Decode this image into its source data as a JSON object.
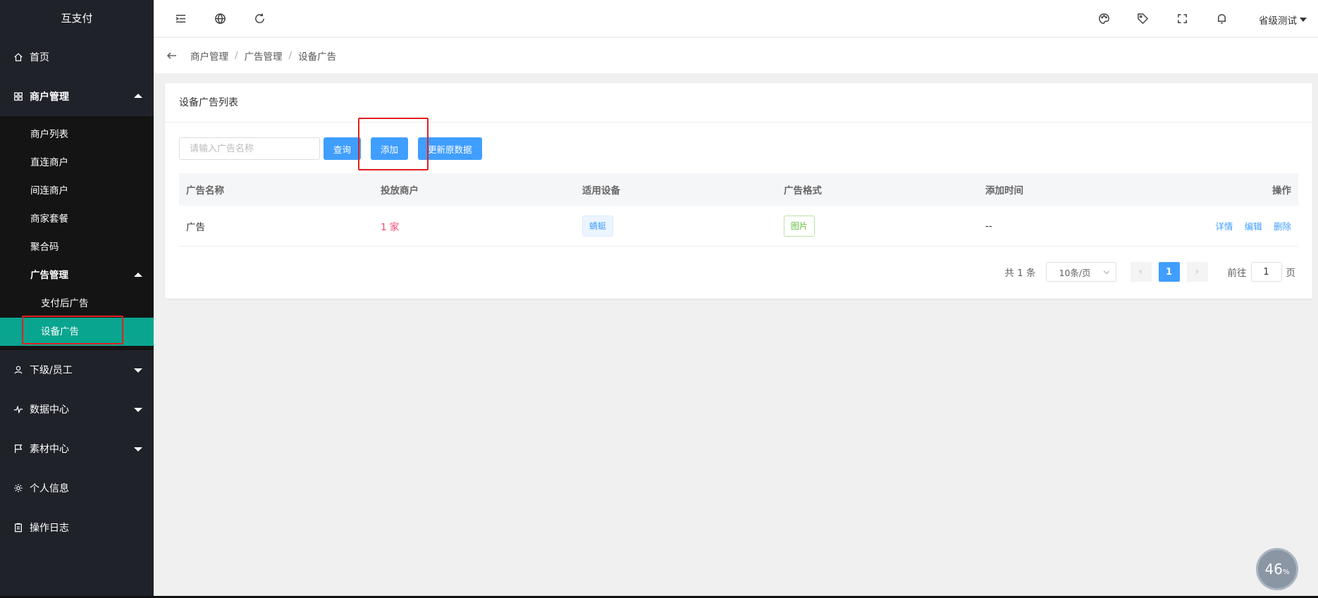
{
  "app": {
    "title": "互支付"
  },
  "sidebar": {
    "home": "首页",
    "merchant_mgmt": "商户管理",
    "merchant_sub": [
      "商户列表",
      "直连商户",
      "间连商户",
      "商家套餐",
      "聚合码"
    ],
    "ad_mgmt": "广告管理",
    "ad_sub": [
      "支付后广告",
      "设备广告"
    ],
    "subordinates": "下级/员工",
    "data_center": "数据中心",
    "material_center": "素材中心",
    "profile": "个人信息",
    "op_log": "操作日志"
  },
  "topbar": {
    "user": "省级测试"
  },
  "breadcrumb": [
    "商户管理",
    "广告管理",
    "设备广告"
  ],
  "card": {
    "title": "设备广告列表",
    "search_placeholder": "请输入广告名称",
    "btn_query": "查询",
    "btn_add": "添加",
    "btn_update": "更新原数据"
  },
  "table": {
    "headers": [
      "广告名称",
      "投放商户",
      "适用设备",
      "广告格式",
      "添加时间",
      "操作"
    ],
    "rows": [
      {
        "name": "广告",
        "merchant": "1 家",
        "device": "蜻蜓",
        "format": "图片",
        "time": "--",
        "ops": [
          "详情",
          "编辑",
          "删除"
        ]
      }
    ]
  },
  "pagination": {
    "total": "共 1 条",
    "page_size": "10条/页",
    "current": "1",
    "goto_label": "前往",
    "goto_value": "1",
    "page_suffix": "页"
  },
  "progress_badge": {
    "value": "46",
    "unit": "%"
  },
  "colors": {
    "sidebar_bg": "#1f2229",
    "active": "#0aa58f",
    "primary": "#409eff",
    "highlight_box": "#e02020"
  }
}
